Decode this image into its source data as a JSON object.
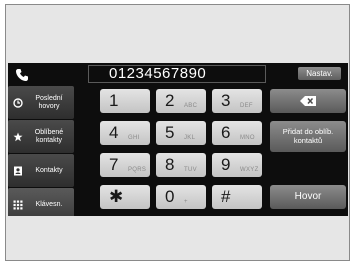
{
  "top_bar": {
    "phone_icon": "phone-handset-icon",
    "number_value": "01234567890",
    "settings_label": "Nastav."
  },
  "sidebar": {
    "items": [
      {
        "label": "Poslední hovory",
        "icon": "clock-icon"
      },
      {
        "label": "Oblíbené kontakty",
        "icon": "star-icon"
      },
      {
        "label": "Kontakty",
        "icon": "contact-card-icon"
      },
      {
        "label": "Klávesn.",
        "icon": "keypad-icon"
      }
    ]
  },
  "keypad": {
    "keys": [
      {
        "digit": "1",
        "letters": ""
      },
      {
        "digit": "2",
        "letters": "ABC"
      },
      {
        "digit": "3",
        "letters": "DEF"
      },
      {
        "digit": "4",
        "letters": "GHI"
      },
      {
        "digit": "5",
        "letters": "JKL"
      },
      {
        "digit": "6",
        "letters": "MNO"
      },
      {
        "digit": "7",
        "letters": "PQRS"
      },
      {
        "digit": "8",
        "letters": "TUV"
      },
      {
        "digit": "9",
        "letters": "WXYZ"
      },
      {
        "digit": "✱",
        "letters": ""
      },
      {
        "digit": "0",
        "letters": "+"
      },
      {
        "digit": "#",
        "letters": ""
      }
    ]
  },
  "actions": {
    "backspace_icon": "backspace-icon",
    "add_favorite_label": "Přidat do oblíb. kontaktů",
    "call_label": "Hovor"
  }
}
